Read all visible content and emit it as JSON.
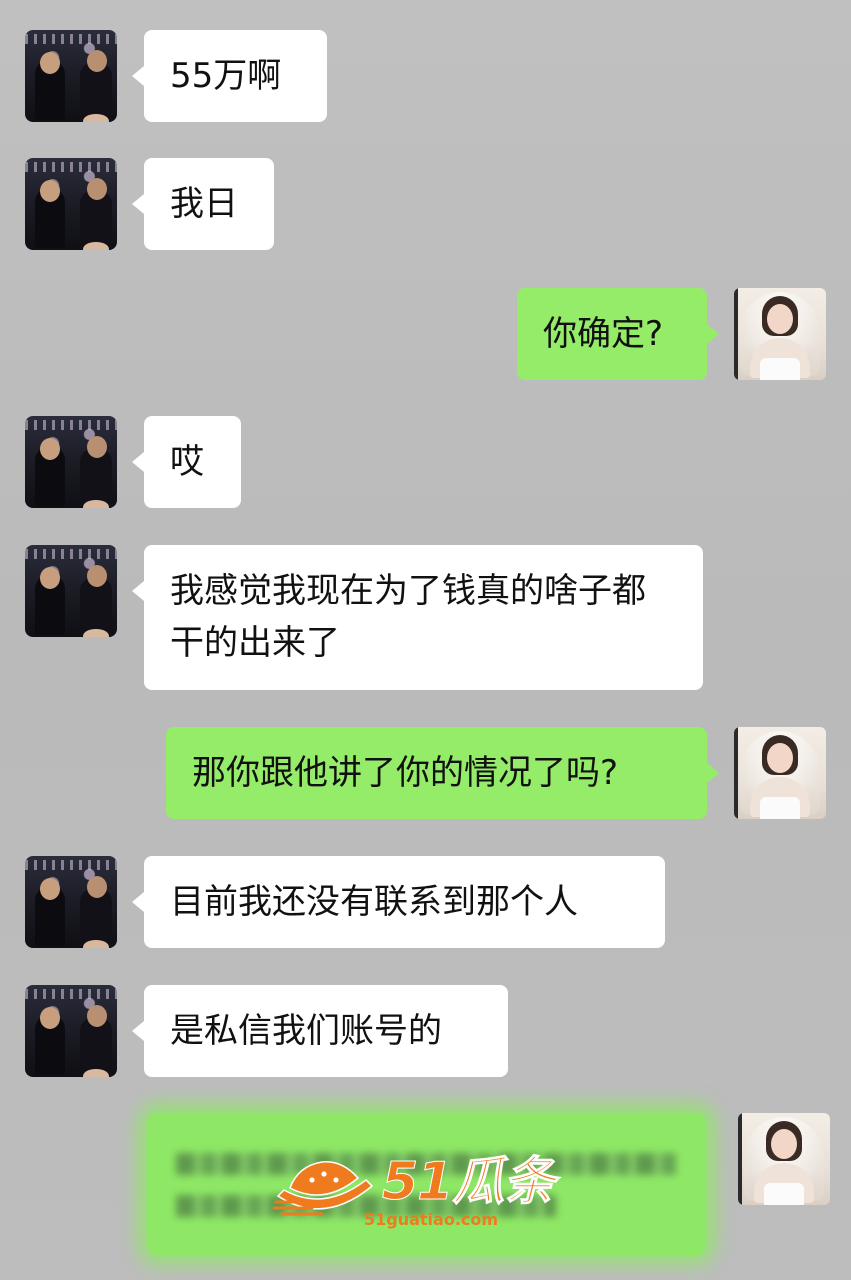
{
  "messages": [
    {
      "side": "in",
      "text": "55万啊"
    },
    {
      "side": "in",
      "text": "我日"
    },
    {
      "side": "out",
      "text": "你确定?"
    },
    {
      "side": "in",
      "text": "哎"
    },
    {
      "side": "in",
      "text": "我感觉我现在为了钱真的啥子都干的出来了"
    },
    {
      "side": "out",
      "text": "那你跟他讲了你的情况了吗?"
    },
    {
      "side": "in",
      "text": "目前我还没有联系到那个人"
    },
    {
      "side": "in",
      "text": "是私信我们账号的"
    }
  ],
  "watermark": {
    "brand": "51瓜条",
    "url": "51guatiao.com"
  },
  "colors": {
    "background": "#bdbdbd",
    "incoming_bubble": "#ffffff",
    "outgoing_bubble": "#95ec69",
    "watermark": "#f07a1e"
  }
}
